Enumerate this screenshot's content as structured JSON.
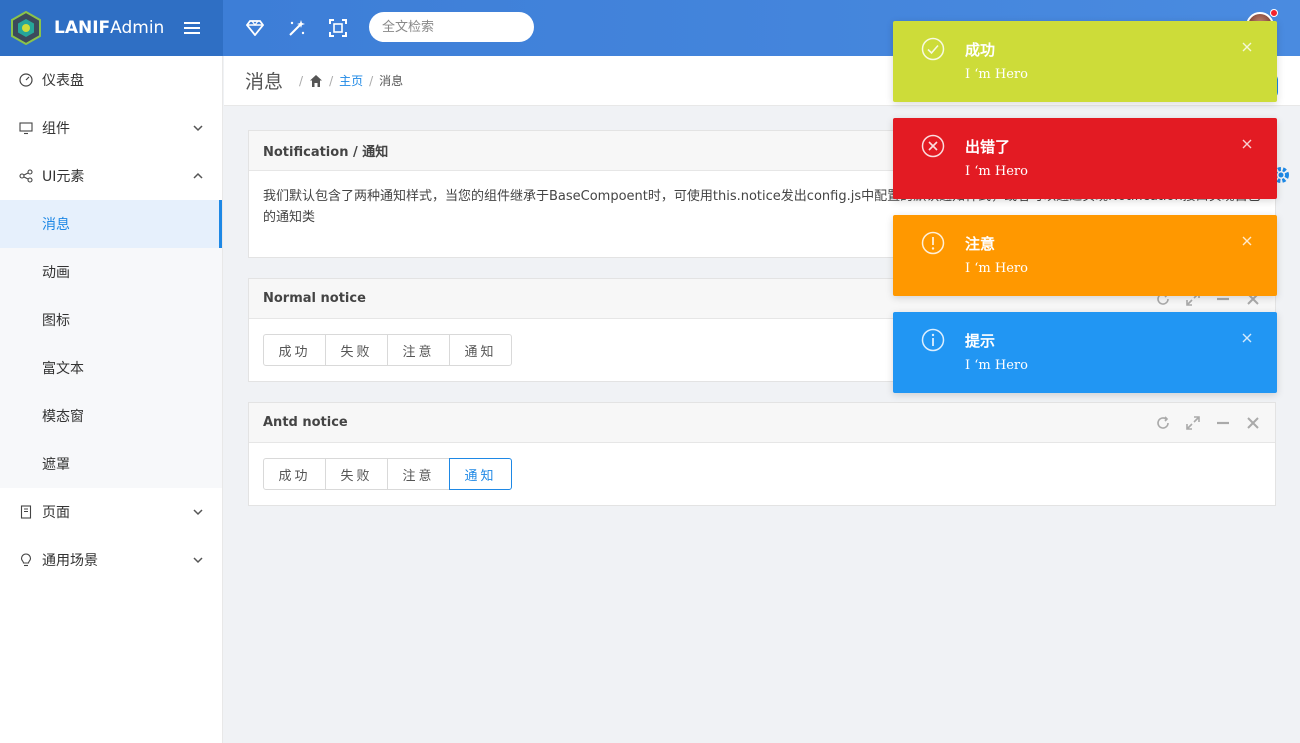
{
  "brand": {
    "bold": "LANIF",
    "light": "Admin"
  },
  "header": {
    "search_placeholder": "全文检索"
  },
  "sidebar": {
    "items": [
      {
        "label": "仪表盘"
      },
      {
        "label": "组件"
      },
      {
        "label": "UI元素"
      },
      {
        "label": "页面"
      },
      {
        "label": "通用场景"
      }
    ],
    "ui_sub": [
      {
        "label": "消息",
        "active": true
      },
      {
        "label": "动画"
      },
      {
        "label": "图标"
      },
      {
        "label": "富文本"
      },
      {
        "label": "模态窗"
      },
      {
        "label": "遮罩"
      }
    ]
  },
  "breadcrumb": {
    "title": "消息",
    "home_link": "主页",
    "current": "消息"
  },
  "panels": {
    "notification": {
      "title": "Notification / 通知",
      "desc": "我们默认包含了两种通知样式，当您的组件继承于BaseCompoent时，可使用this.notice发出config.js中配置的默认通知样式，或者可以通过实现Notification接口实现自已的通知类"
    },
    "normal": {
      "title": "Normal notice",
      "buttons": [
        "成功",
        "失败",
        "注意",
        "通知"
      ]
    },
    "antd": {
      "title": "Antd notice",
      "buttons": [
        "成功",
        "失败",
        "注意",
        "通知"
      ]
    }
  },
  "toasts": [
    {
      "title": "成功",
      "message": "I ‘m Hero",
      "color": "#cddc39",
      "icon": "check-circle-icon"
    },
    {
      "title": "出错了",
      "message": "I ‘m Hero",
      "color": "#e31b23",
      "icon": "close-circle-icon"
    },
    {
      "title": "注意",
      "message": "I ‘m Hero",
      "color": "#ff9800",
      "icon": "exclamation-circle-icon"
    },
    {
      "title": "提示",
      "message": "I ‘m Hero",
      "color": "#2196f3",
      "icon": "info-circle-icon"
    }
  ],
  "colors": {
    "header": "#3a7bd5",
    "accent": "#1e88e5"
  }
}
